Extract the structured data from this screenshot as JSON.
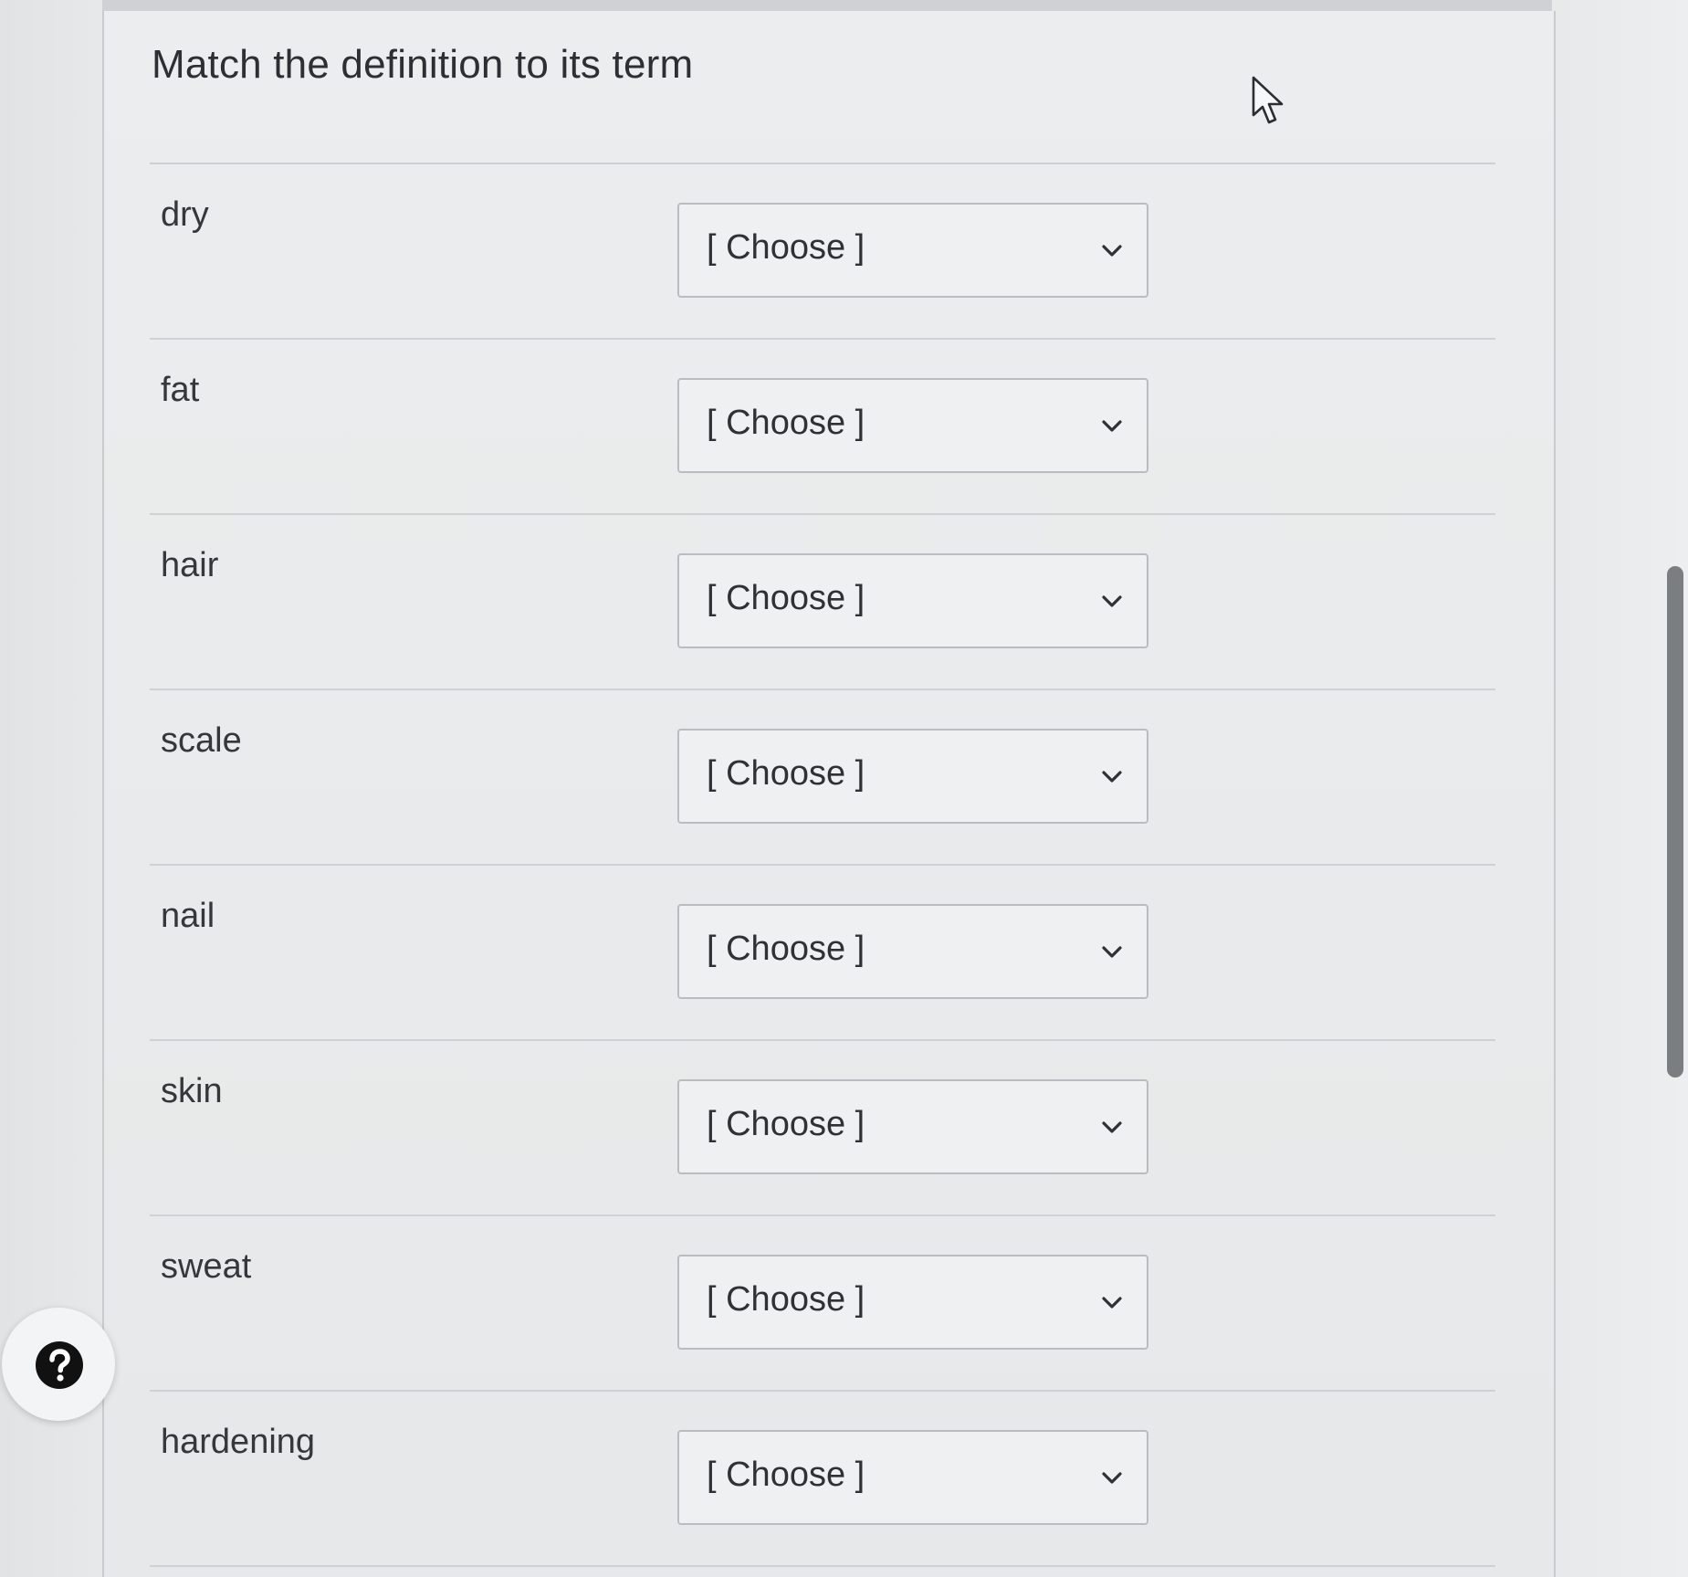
{
  "question": {
    "title": "Match the definition to its term"
  },
  "rows": [
    {
      "term": "dry",
      "selected": "[ Choose ]"
    },
    {
      "term": "fat",
      "selected": "[ Choose ]"
    },
    {
      "term": "hair",
      "selected": "[ Choose ]"
    },
    {
      "term": "scale",
      "selected": "[ Choose ]"
    },
    {
      "term": "nail",
      "selected": "[ Choose ]"
    },
    {
      "term": "skin",
      "selected": "[ Choose ]"
    },
    {
      "term": "sweat",
      "selected": "[ Choose ]"
    },
    {
      "term": "hardening",
      "selected": "[ Choose ]"
    }
  ],
  "icons": {
    "help": "question-circle-icon",
    "dropdown": "chevron-down-icon",
    "cursor": "mouse-pointer-icon"
  },
  "colors": {
    "panel_background": "#e8eaeb",
    "text": "#2c2f33",
    "select_border": "#b9bdc1",
    "help_icon": "#111111"
  }
}
